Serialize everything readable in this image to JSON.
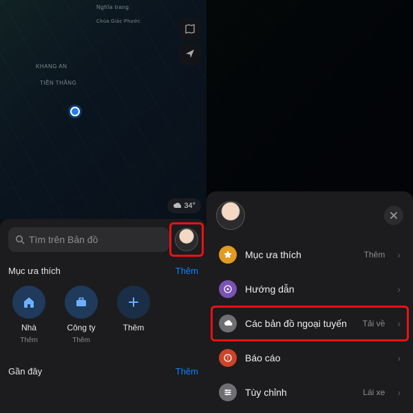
{
  "left": {
    "map_labels": {
      "nghiatrang": "Nghĩa trang",
      "khang_an": "KHANG AN",
      "tien_thang": "TIÊN THẮNG",
      "chua": "Chùa Giác Phước"
    },
    "weather": {
      "temp": "34°"
    },
    "search_placeholder": "Tìm trên Bản đồ",
    "favorites_title": "Mục ưa thích",
    "favorites_more": "Thêm",
    "favorites": [
      {
        "icon": "home-icon",
        "label": "Nhà",
        "sub": "Thêm"
      },
      {
        "icon": "briefcase-icon",
        "label": "Công ty",
        "sub": "Thêm"
      },
      {
        "icon": "plus-icon",
        "label": "Thêm",
        "sub": ""
      }
    ],
    "recent_title": "Gần đây",
    "recent_more": "Thêm"
  },
  "right": {
    "menu": [
      {
        "icon": "star-icon",
        "label": "Mục ưa thích",
        "trail": "Thêm"
      },
      {
        "icon": "guide-icon",
        "label": "Hướng dẫn",
        "trail": ""
      },
      {
        "icon": "cloud-icon",
        "label": "Các bản đồ ngoại tuyến",
        "trail": "Tải về"
      },
      {
        "icon": "report-icon",
        "label": "Báo cáo",
        "trail": ""
      },
      {
        "icon": "customize-icon",
        "label": "Tùy chỉnh",
        "trail": "Lái xe"
      }
    ]
  },
  "colors": {
    "accent": "#0a84ff",
    "highlight": "#e11"
  }
}
